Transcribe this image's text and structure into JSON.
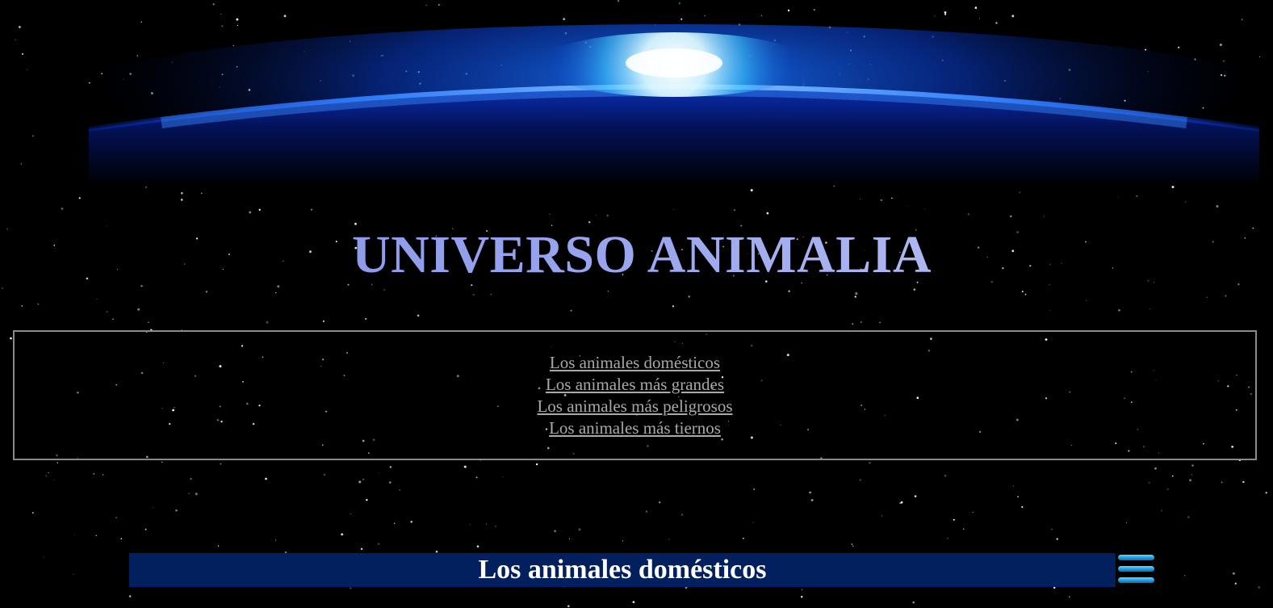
{
  "header": {
    "title": "UNIVERSO ANIMALIA"
  },
  "nav": {
    "links": [
      {
        "label": "Los animales domésticos"
      },
      {
        "label": "Los animales más grandes"
      },
      {
        "label": "Los animales más peligrosos"
      },
      {
        "label": "Los animales más tiernos"
      }
    ]
  },
  "section": {
    "title": "Los animales domésticos",
    "menu_icon": "hamburger-menu-icon"
  },
  "colors": {
    "background": "#000000",
    "title_gradient_start": "#7e8fe6",
    "title_gradient_end": "#c8cdf5",
    "nav_link": "#a9a9a9",
    "nav_border": "#8a8a8a",
    "section_bar": "#03205e",
    "menu_icon": "#1e9be0",
    "planet_glow": "#0a5cff"
  }
}
